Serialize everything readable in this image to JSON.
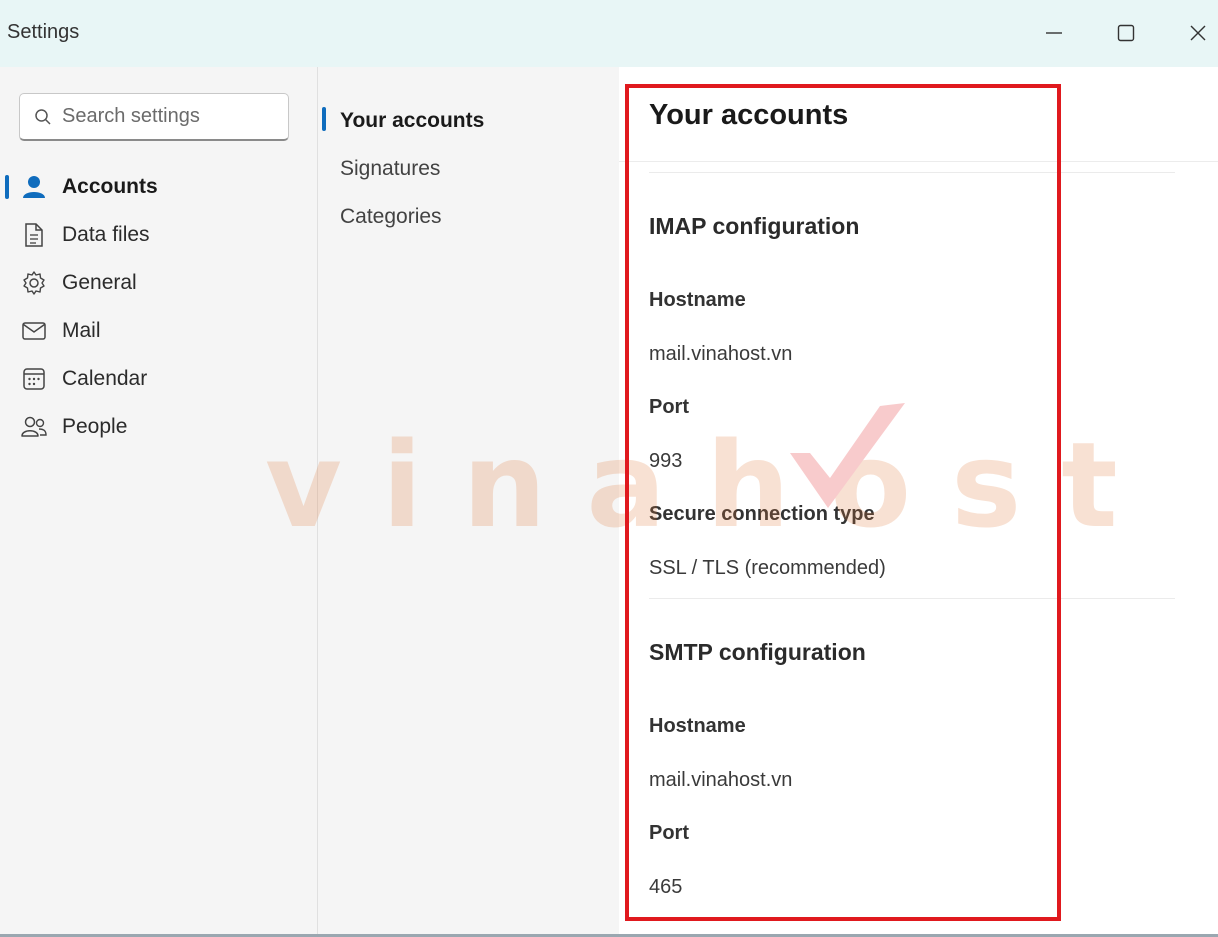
{
  "window": {
    "title": "Settings"
  },
  "search": {
    "placeholder": "Search settings"
  },
  "left_nav": {
    "items": [
      {
        "label": "Accounts",
        "icon": "person-icon"
      },
      {
        "label": "Data files",
        "icon": "document-icon"
      },
      {
        "label": "General",
        "icon": "gear-icon"
      },
      {
        "label": "Mail",
        "icon": "mail-icon"
      },
      {
        "label": "Calendar",
        "icon": "calendar-icon"
      },
      {
        "label": "People",
        "icon": "people-icon"
      }
    ]
  },
  "sub_nav": {
    "items": [
      {
        "label": "Your accounts"
      },
      {
        "label": "Signatures"
      },
      {
        "label": "Categories"
      }
    ]
  },
  "content": {
    "title": "Your accounts",
    "imap": {
      "title": "IMAP configuration",
      "hostname_label": "Hostname",
      "hostname_value": "mail.vinahost.vn",
      "port_label": "Port",
      "port_value": "993",
      "secure_label": "Secure connection type",
      "secure_value": "SSL / TLS (recommended)"
    },
    "smtp": {
      "title": "SMTP configuration",
      "hostname_label": "Hostname",
      "hostname_value": "mail.vinahost.vn",
      "port_label": "Port",
      "port_value": "465"
    }
  },
  "watermark": {
    "text": "vinahost"
  },
  "colors": {
    "accent": "#0f6cbd",
    "highlight": "#e0191e",
    "titlebar": "#e8f6f6"
  }
}
